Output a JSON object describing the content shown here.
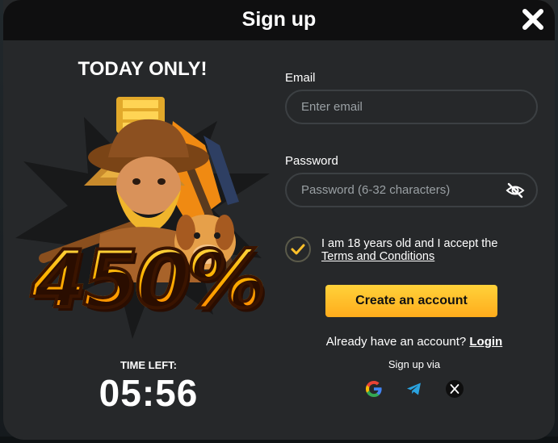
{
  "modal": {
    "title": "Sign up",
    "close_icon": "close-icon"
  },
  "promo": {
    "headline": "TODAY ONLY!",
    "bonus": "450%",
    "art_icon": "miner-dog-gold-illustration",
    "timer_label": "TIME LEFT:",
    "timer_value": "05:56"
  },
  "form": {
    "email": {
      "label": "Email",
      "value": "",
      "placeholder": "Enter email"
    },
    "password": {
      "label": "Password",
      "value": "",
      "placeholder": "Password (6-32 characters)",
      "toggle_icon": "eye-slash-icon"
    },
    "consent": {
      "checked": true,
      "text": "I am 18 years old and I accept the",
      "link": "Terms and Conditions"
    },
    "submit_label": "Create an account",
    "login_prompt": "Already have an account?",
    "login_link": "Login",
    "signup_via": "Sign up via",
    "social": [
      "google-icon",
      "telegram-icon",
      "x-icon"
    ]
  },
  "colors": {
    "accent": "#ffc02a",
    "panel": "#26282a",
    "header": "#0f0f10",
    "input_border": "#3c4043"
  }
}
